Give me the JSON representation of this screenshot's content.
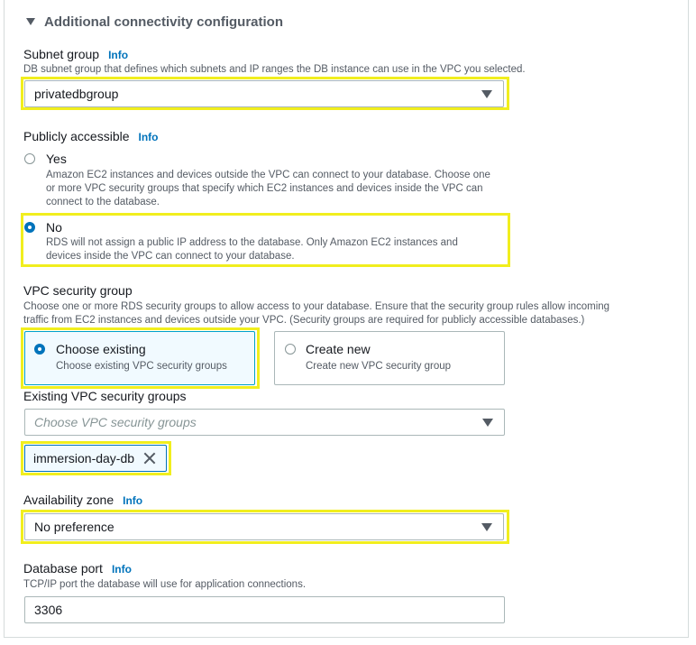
{
  "section": {
    "title": "Additional connectivity configuration"
  },
  "info_label": "Info",
  "subnet_group": {
    "label": "Subnet group",
    "description": "DB subnet group that defines which subnets and IP ranges the DB instance can use in the VPC you selected.",
    "value": "privatedbgroup"
  },
  "publicly_accessible": {
    "label": "Publicly accessible",
    "options": [
      {
        "label": "Yes",
        "description_1": "Amazon EC2 instances and devices outside the VPC can connect to your database. Choose one",
        "description_2": "or more VPC security groups that specify which EC2 instances and devices inside the VPC can",
        "description_3": "connect to the database.",
        "selected": false
      },
      {
        "label": "No",
        "description_1": "RDS will not assign a public IP address to the database. Only Amazon EC2 instances and",
        "description_2": "devices inside the VPC can connect to your database.",
        "selected": true
      }
    ]
  },
  "vpc_security_group": {
    "label": "VPC security group",
    "description_1": "Choose one or more RDS security groups to allow access to your database. Ensure that the security group rules allow incoming",
    "description_2": "traffic from EC2 instances and devices outside your VPC. (Security groups are required for publicly accessible databases.)",
    "tiles": [
      {
        "label": "Choose existing",
        "description": "Choose existing VPC security groups",
        "selected": true
      },
      {
        "label": "Create new",
        "description": "Create new VPC security group",
        "selected": false
      }
    ]
  },
  "existing_groups": {
    "label": "Existing VPC security groups",
    "placeholder": "Choose VPC security groups",
    "tokens": [
      "immersion-day-db"
    ]
  },
  "availability_zone": {
    "label": "Availability zone",
    "value": "No preference"
  },
  "database_port": {
    "label": "Database port",
    "description": "TCP/IP port the database will use for application connections.",
    "value": "3306"
  },
  "colors": {
    "highlight": "#f1ee1e",
    "accent": "#0073bb"
  }
}
